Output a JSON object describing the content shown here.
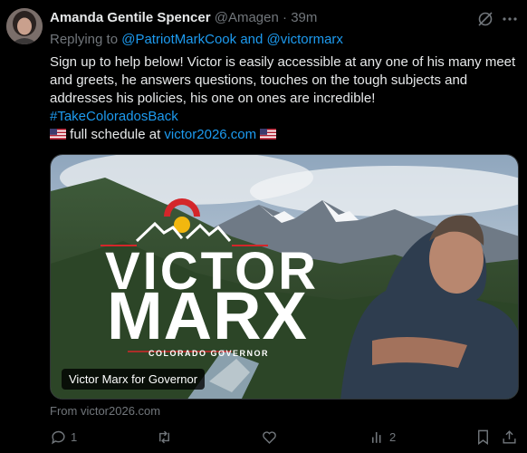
{
  "tweet": {
    "author_name": "Amanda Gentile Spencer",
    "handle": "@Amagen",
    "separator": "·",
    "time": "39m",
    "replying_prefix": "Replying to",
    "reply_to_1": "@PatriotMarkCook",
    "reply_and": "and",
    "reply_to_2": "@victormarx",
    "body": "Sign up to help below! Victor is easily accessible at any one of his many meet and greets, he answers questions, touches on the tough subjects and addresses his policies, his one on ones are incredible!",
    "hashtag": "#TakeColoradosBack",
    "schedule_text": "full schedule at",
    "schedule_link": "victor2026.com"
  },
  "media": {
    "logo_line1": "VICTOR",
    "logo_line2": "MARX",
    "logo_subtitle": "COLORADO GOVERNOR",
    "caption": "Victor Marx for Governor",
    "source": "From victor2026.com"
  },
  "actions": {
    "reply_count": "1",
    "retweet_count": "",
    "like_count": "",
    "views_count": "2"
  },
  "icons": [
    "avatar",
    "grok-icon",
    "more-icon",
    "flag-icon",
    "reply-icon",
    "retweet-icon",
    "like-icon",
    "views-icon",
    "bookmark-icon",
    "share-icon"
  ],
  "colors": {
    "background": "#000000",
    "text": "#e7e9ea",
    "secondary": "#71767b",
    "link": "#1d9bf0"
  }
}
